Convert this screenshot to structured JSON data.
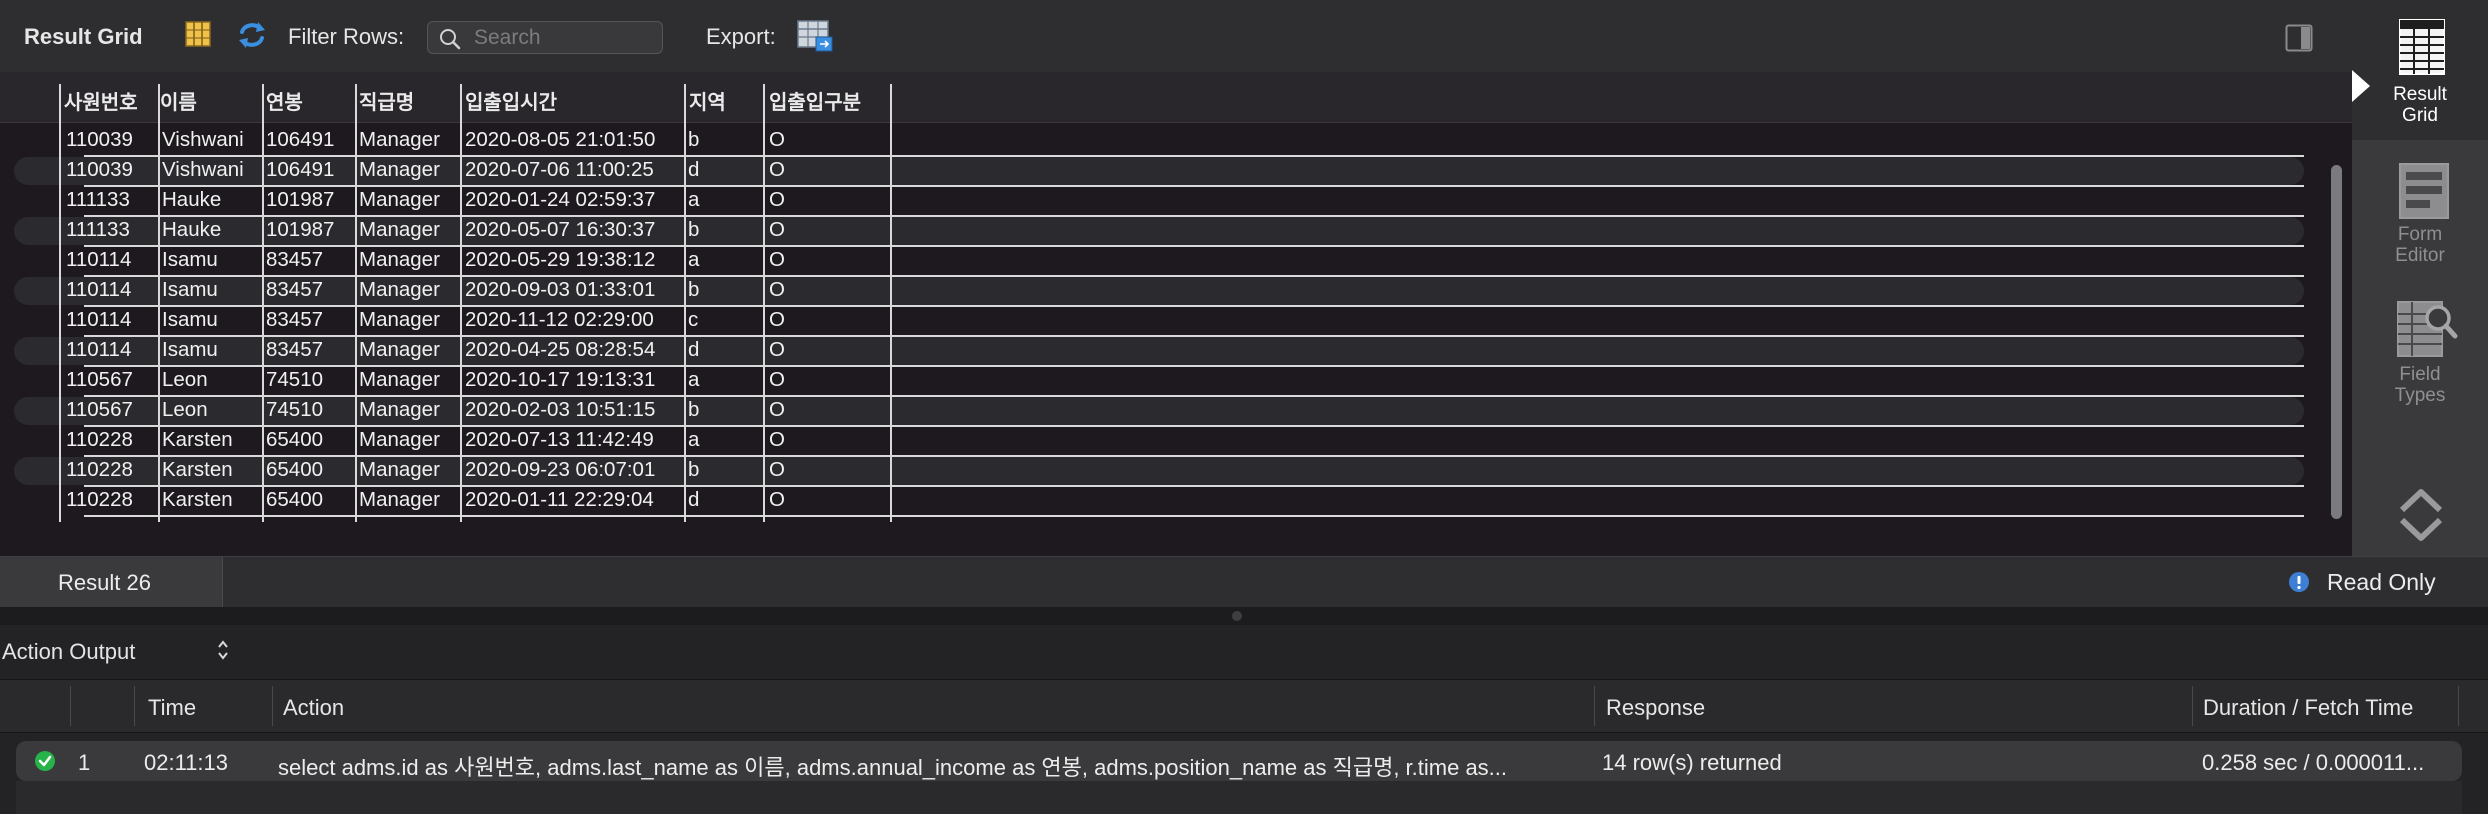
{
  "toolbar": {
    "title": "Result Grid",
    "filter_label": "Filter Rows:",
    "search_placeholder": "Search",
    "export_label": "Export:"
  },
  "grid": {
    "columns": [
      "사원번호",
      "이름",
      "연봉",
      "직급명",
      "입출입시간",
      "지역",
      "입출입구분"
    ],
    "rows": [
      [
        "110039",
        "Vishwani",
        "106491",
        "Manager",
        "2020-08-05 21:01:50",
        "b",
        "O"
      ],
      [
        "110039",
        "Vishwani",
        "106491",
        "Manager",
        "2020-07-06 11:00:25",
        "d",
        "O"
      ],
      [
        "111133",
        "Hauke",
        "101987",
        "Manager",
        "2020-01-24 02:59:37",
        "a",
        "O"
      ],
      [
        "111133",
        "Hauke",
        "101987",
        "Manager",
        "2020-05-07 16:30:37",
        "b",
        "O"
      ],
      [
        "110114",
        "Isamu",
        "83457",
        "Manager",
        "2020-05-29 19:38:12",
        "a",
        "O"
      ],
      [
        "110114",
        "Isamu",
        "83457",
        "Manager",
        "2020-09-03 01:33:01",
        "b",
        "O"
      ],
      [
        "110114",
        "Isamu",
        "83457",
        "Manager",
        "2020-11-12 02:29:00",
        "c",
        "O"
      ],
      [
        "110114",
        "Isamu",
        "83457",
        "Manager",
        "2020-04-25 08:28:54",
        "d",
        "O"
      ],
      [
        "110567",
        "Leon",
        "74510",
        "Manager",
        "2020-10-17 19:13:31",
        "a",
        "O"
      ],
      [
        "110567",
        "Leon",
        "74510",
        "Manager",
        "2020-02-03 10:51:15",
        "b",
        "O"
      ],
      [
        "110228",
        "Karsten",
        "65400",
        "Manager",
        "2020-07-13 11:42:49",
        "a",
        "O"
      ],
      [
        "110228",
        "Karsten",
        "65400",
        "Manager",
        "2020-09-23 06:07:01",
        "b",
        "O"
      ],
      [
        "110228",
        "Karsten",
        "65400",
        "Manager",
        "2020-01-11 22:29:04",
        "d",
        "O"
      ]
    ]
  },
  "sidebar": {
    "result_grid": "Result\nGrid",
    "form_editor": "Form\nEditor",
    "field_types": "Field\nTypes"
  },
  "tabs": {
    "result_label": "Result 26",
    "read_only": "Read Only"
  },
  "action_output": {
    "label": "Action Output",
    "headers": {
      "time": "Time",
      "action": "Action",
      "response": "Response",
      "duration": "Duration / Fetch Time"
    },
    "rows": [
      {
        "num": "1",
        "time": "02:11:13",
        "action": "select adms.id as 사원번호,  adms.last_name as 이름,  adms.annual_income as 연봉,  adms.position_name as 직급명,   r.time as...",
        "response": "14 row(s) returned",
        "duration": "0.258 sec / 0.000011..."
      }
    ]
  },
  "colors": {
    "success": "#27b24a",
    "info_badge": "#3d7fd4",
    "refresh": "#3a8fe0",
    "grid_icon": "#e3b43a"
  }
}
